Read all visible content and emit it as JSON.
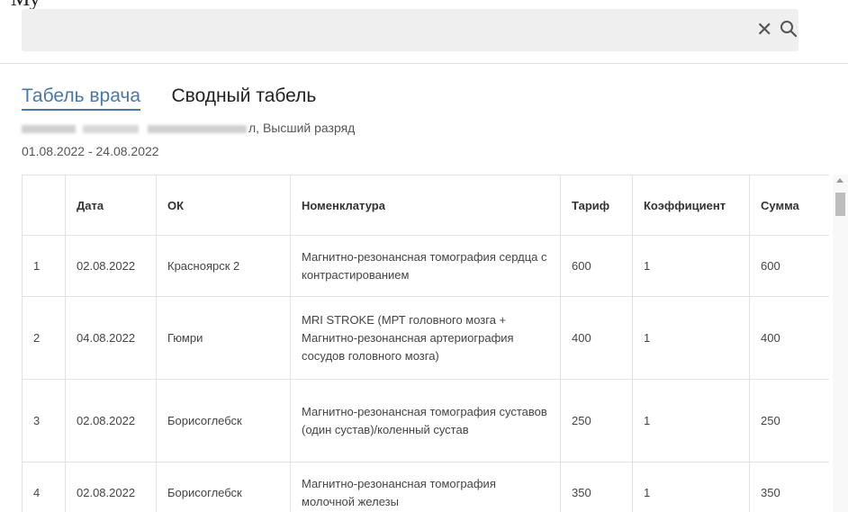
{
  "partial_top_text": "Му",
  "search": {
    "value": "",
    "placeholder": ""
  },
  "tabs": [
    {
      "label": "Табель врача",
      "active": true
    },
    {
      "label": "Сводный табель",
      "active": false
    }
  ],
  "doctor": {
    "name_visible_suffix": "л, Высший разряд"
  },
  "period": "01.08.2022 - 24.08.2022",
  "table": {
    "columns": [
      "",
      "Дата",
      "ОК",
      "Номенклатура",
      "Тариф",
      "Коэффициент",
      "Сумма"
    ],
    "rows": [
      {
        "n": "1",
        "date": "02.08.2022",
        "ok": "Красноярск 2",
        "item": "Магнитно-резонансная томография сердца с контрастированием",
        "tariff": "600",
        "coef": "1",
        "sum": "600"
      },
      {
        "n": "2",
        "date": "04.08.2022",
        "ok": "Гюмри",
        "item": "MRI STROKE (МРТ головного мозга + Магнитно-резонансная артериография сосудов головного мозга)",
        "tariff": "400",
        "coef": "1",
        "sum": "400"
      },
      {
        "n": "3",
        "date": "02.08.2022",
        "ok": "Борисоглебск",
        "item": "Магнитно-резонансная томография суставов (один сустав)/коленный сустав",
        "tariff": "250",
        "coef": "1",
        "sum": "250"
      },
      {
        "n": "4",
        "date": "02.08.2022",
        "ok": "Борисоглебск",
        "item": "Магнитно-резонансная томография молочной железы",
        "tariff": "350",
        "coef": "1",
        "sum": "350"
      }
    ]
  },
  "icons": {
    "clear": "close-icon",
    "search": "search-icon"
  }
}
